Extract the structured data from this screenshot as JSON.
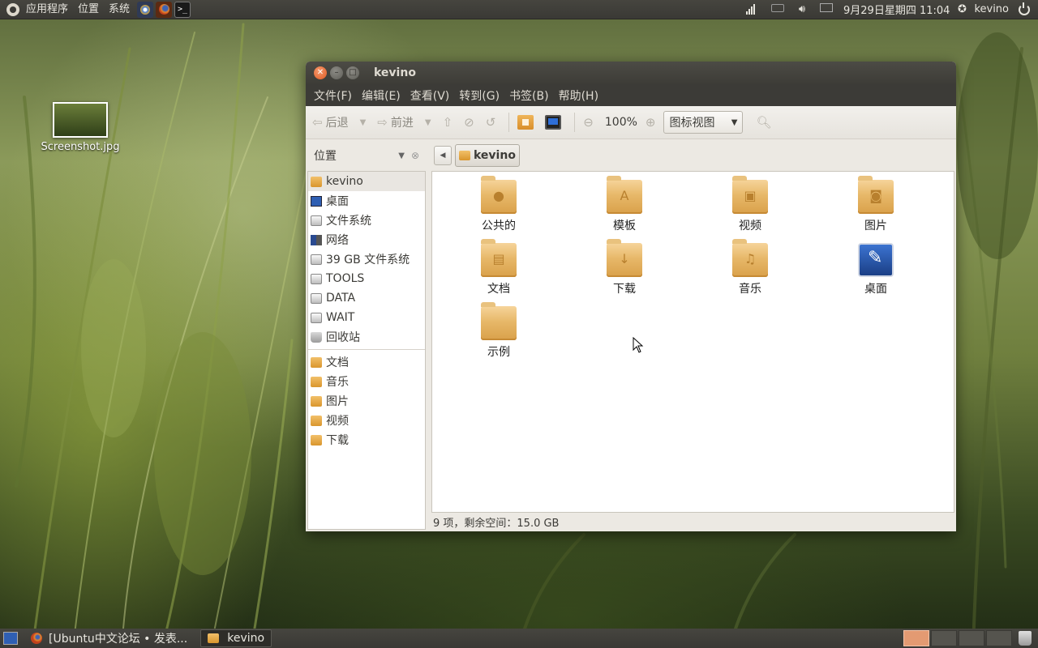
{
  "top_panel": {
    "menus": [
      "应用程序",
      "位置",
      "系统"
    ],
    "clock": "9月29日星期四 11:04",
    "user": "kevino"
  },
  "desktop": {
    "icon_label": "Screenshot.jpg"
  },
  "window": {
    "title": "kevino",
    "menubar": [
      "文件(F)",
      "编辑(E)",
      "查看(V)",
      "转到(G)",
      "书签(B)",
      "帮助(H)"
    ],
    "toolbar": {
      "back": "后退",
      "forward": "前进",
      "zoom": "100%",
      "view_mode": "图标视图"
    },
    "places_label": "位置",
    "breadcrumb": "kevino",
    "sidebar": {
      "devices": [
        {
          "label": "kevino",
          "icon": "home-folder-icon"
        },
        {
          "label": "桌面",
          "icon": "desktop-icon"
        },
        {
          "label": "文件系统",
          "icon": "drive-icon"
        },
        {
          "label": "网络",
          "icon": "network-icon"
        },
        {
          "label": "39 GB 文件系统",
          "icon": "drive-icon"
        },
        {
          "label": "TOOLS",
          "icon": "drive-icon"
        },
        {
          "label": "DATA",
          "icon": "drive-icon"
        },
        {
          "label": "WAIT",
          "icon": "drive-icon"
        },
        {
          "label": "回收站",
          "icon": "trash-icon"
        }
      ],
      "bookmarks": [
        {
          "label": "文档",
          "icon": "folder-icon"
        },
        {
          "label": "音乐",
          "icon": "folder-icon"
        },
        {
          "label": "图片",
          "icon": "folder-icon"
        },
        {
          "label": "视频",
          "icon": "folder-icon"
        },
        {
          "label": "下载",
          "icon": "folder-icon"
        }
      ]
    },
    "files": [
      {
        "label": "公共的",
        "icon": "public-folder-icon",
        "glyph": "●"
      },
      {
        "label": "模板",
        "icon": "templates-folder-icon",
        "glyph": "A"
      },
      {
        "label": "视频",
        "icon": "videos-folder-icon",
        "glyph": "▣"
      },
      {
        "label": "图片",
        "icon": "pictures-folder-icon",
        "glyph": "◙"
      },
      {
        "label": "文档",
        "icon": "documents-folder-icon",
        "glyph": "▤"
      },
      {
        "label": "下载",
        "icon": "downloads-folder-icon",
        "glyph": "↓"
      },
      {
        "label": "音乐",
        "icon": "music-folder-icon",
        "glyph": "♫"
      },
      {
        "label": "桌面",
        "icon": "desktop-icon",
        "glyph": ""
      },
      {
        "label": "示例",
        "icon": "examples-folder-icon",
        "glyph": ""
      }
    ],
    "status": "9 项，剩余空间：15.0 GB"
  },
  "bottom_panel": {
    "tasks": [
      {
        "label": "[Ubuntu中文论坛 • 发表...",
        "icon": "firefox-icon"
      },
      {
        "label": "kevino",
        "icon": "folder-icon"
      }
    ]
  }
}
